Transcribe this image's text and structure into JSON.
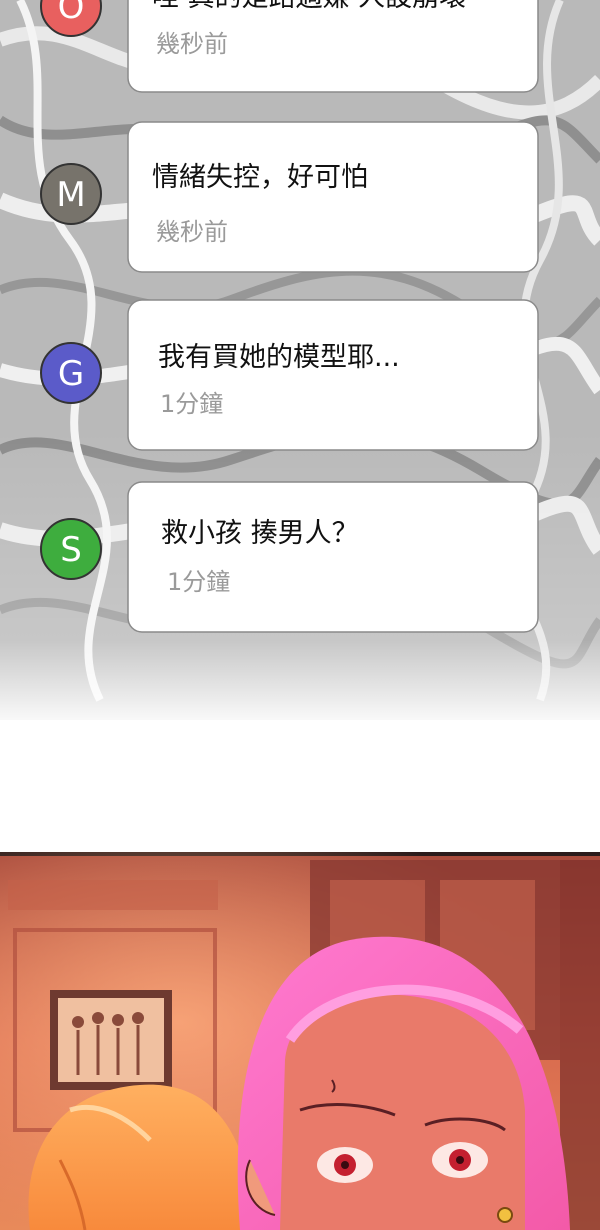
{
  "comments": [
    {
      "initial": "O",
      "color": "#e8605f",
      "text": "哇 真的是路過嫌 人設崩壞",
      "time": "幾秒前"
    },
    {
      "initial": "M",
      "color": "#77736b",
      "text": "情緒失控，好可怕",
      "time": "幾秒前"
    },
    {
      "initial": "G",
      "color": "#5b5bc9",
      "text": "我有買她的模型耶...",
      "time": "1分鐘"
    },
    {
      "initial": "S",
      "color": "#3ead3e",
      "text": "救小孩 揍男人？",
      "time": "1分鐘"
    }
  ]
}
